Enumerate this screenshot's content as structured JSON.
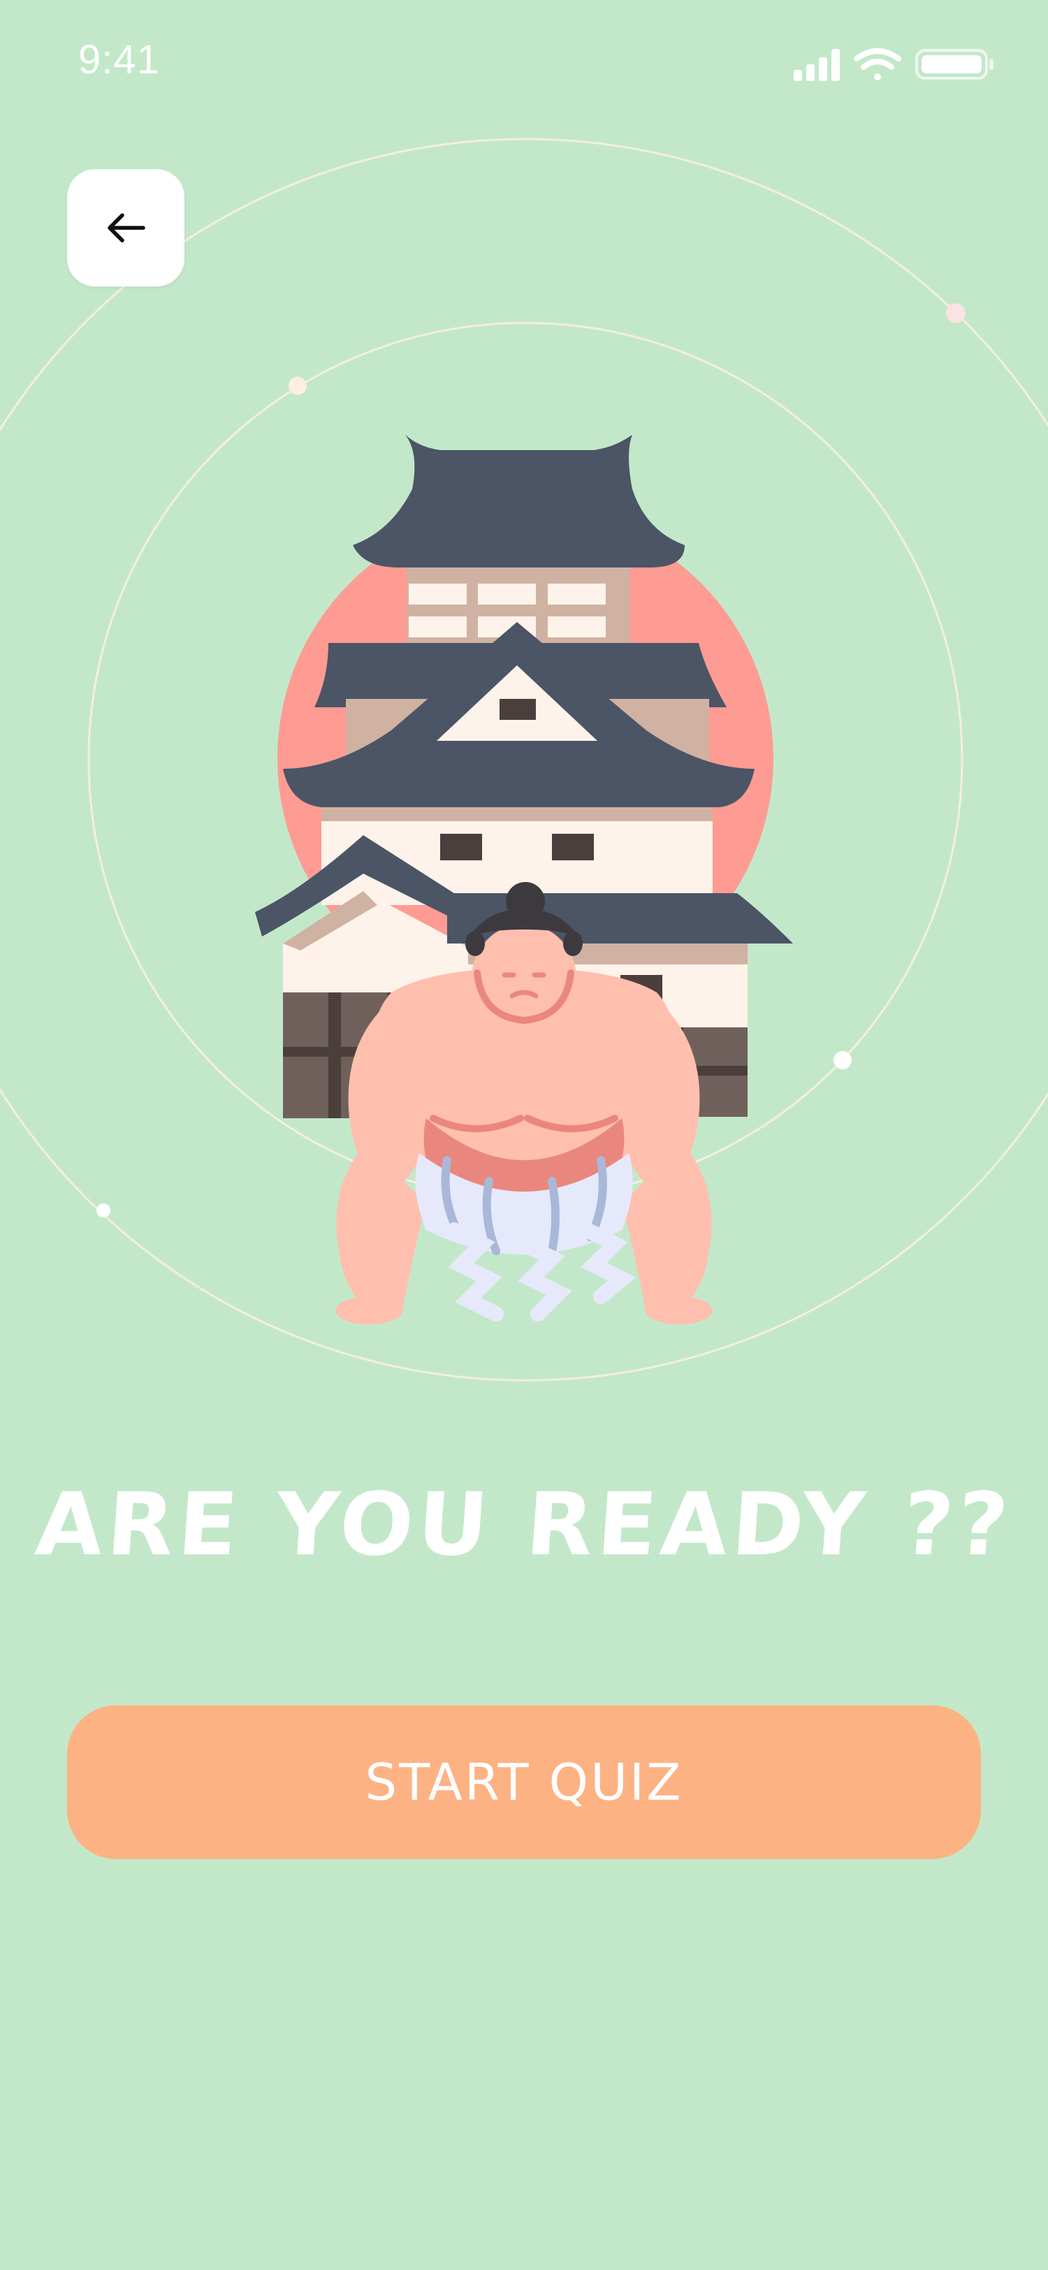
{
  "status_bar": {
    "time": "9:41",
    "icons": [
      "cellular-signal-icon",
      "wifi-icon",
      "battery-icon"
    ]
  },
  "header": {
    "back_icon": "arrow-left-icon"
  },
  "illustration": {
    "subject": "japanese-castle-with-sumo-wrestler-illustration"
  },
  "main": {
    "headline": "ARE YOU READY ??",
    "start_button_label": "START QUIZ"
  },
  "colors": {
    "background": "#c3e8c9",
    "button": "#fdb283",
    "sun": "#fe9b93",
    "roof": "#4b5566",
    "skin": "#ffbfae"
  }
}
